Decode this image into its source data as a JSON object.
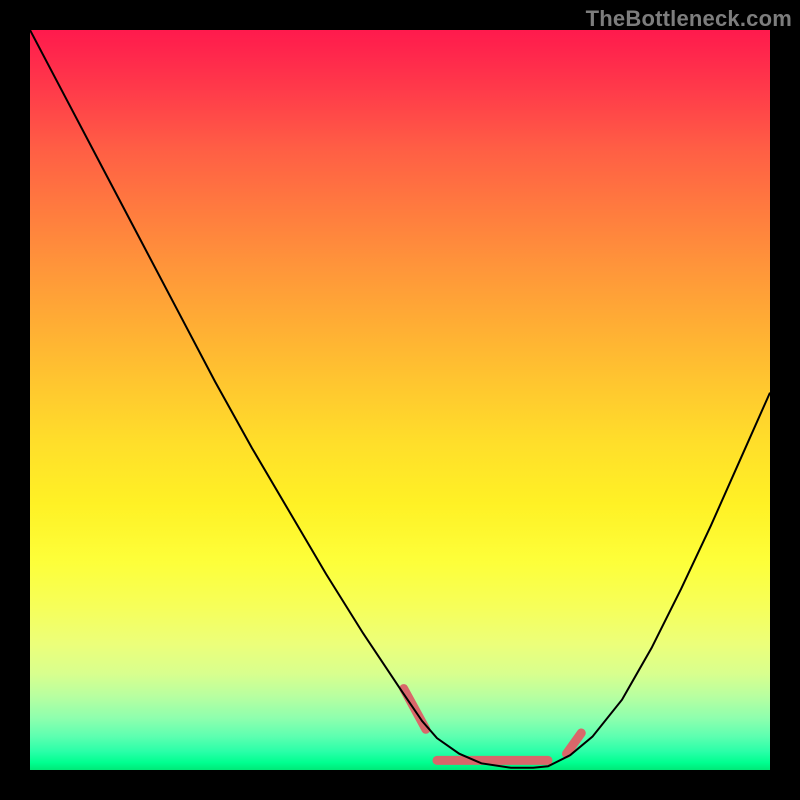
{
  "watermark": {
    "text": "TheBottleneck.com"
  },
  "colors": {
    "curve_black": "#000000",
    "annotation_pink": "#d9676a"
  },
  "chart_data": {
    "type": "line",
    "title": "",
    "xlabel": "",
    "ylabel": "",
    "xlim": [
      0,
      100
    ],
    "ylim": [
      0,
      100
    ],
    "grid": false,
    "series": [
      {
        "name": "bottleneck-curve",
        "x": [
          0,
          5,
          10,
          15,
          20,
          25,
          30,
          35,
          40,
          45,
          50,
          53,
          55,
          58,
          61,
          65,
          68,
          70,
          73,
          76,
          80,
          84,
          88,
          92,
          96,
          100
        ],
        "y": [
          100,
          90.5,
          81,
          71.5,
          62,
          52.5,
          43.5,
          35,
          26.5,
          18.5,
          11,
          6.6,
          4.3,
          2.2,
          0.9,
          0.3,
          0.3,
          0.5,
          2.0,
          4.5,
          9.5,
          16.5,
          24.5,
          33,
          42,
          51
        ],
        "stroke": "#000000",
        "stroke_width": 2
      },
      {
        "name": "annotation-left-tick",
        "x": [
          50.5,
          53.5
        ],
        "y": [
          11.0,
          5.5
        ],
        "stroke": "#d9676a",
        "stroke_width": 9
      },
      {
        "name": "annotation-flat-band",
        "x": [
          55,
          70
        ],
        "y": [
          1.3,
          1.3
        ],
        "stroke": "#d9676a",
        "stroke_width": 9
      },
      {
        "name": "annotation-right-tick",
        "x": [
          72.5,
          74.5
        ],
        "y": [
          2.2,
          5.0
        ],
        "stroke": "#d9676a",
        "stroke_width": 9
      }
    ]
  }
}
